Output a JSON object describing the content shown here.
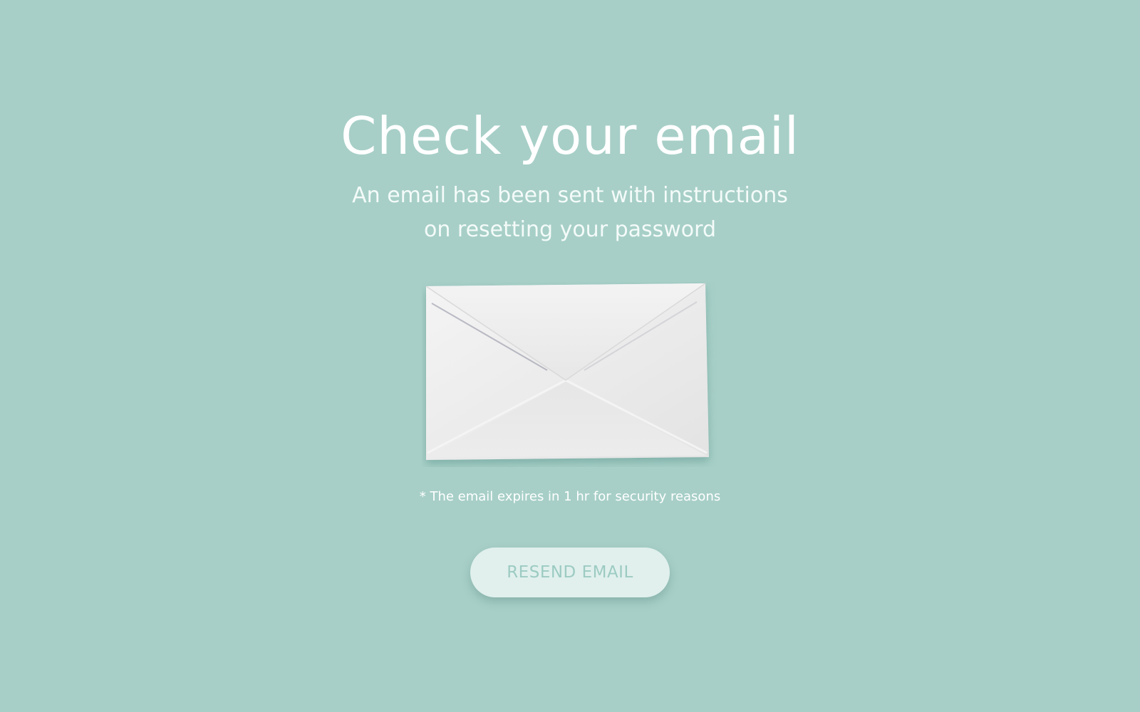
{
  "header": {
    "title": "Check your email"
  },
  "message": {
    "line1": "An email has been sent with instructions",
    "line2": "on resetting your password"
  },
  "illustration": {
    "icon": "envelope-icon"
  },
  "note": {
    "text": "* The email expires in 1 hr for security reasons"
  },
  "actions": {
    "resend_label": "RESEND EMAIL"
  },
  "colors": {
    "background": "#a7cfc7",
    "button_background": "#e1f0ed",
    "button_text": "#9ccbc2",
    "text": "#ffffff"
  }
}
